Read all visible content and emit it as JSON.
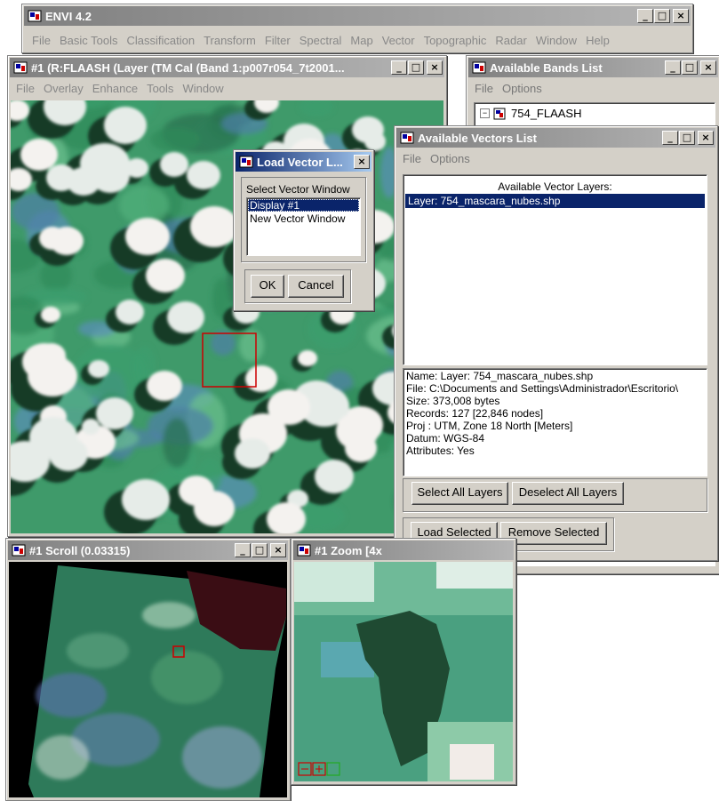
{
  "main": {
    "title": "ENVI 4.2",
    "menu": [
      "File",
      "Basic Tools",
      "Classification",
      "Transform",
      "Filter",
      "Spectral",
      "Map",
      "Vector",
      "Topographic",
      "Radar",
      "Window",
      "Help"
    ]
  },
  "image_window": {
    "title": "#1 (R:FLAASH (Layer (TM Cal (Band 1:p007r054_7t2001...",
    "menu": [
      "File",
      "Overlay",
      "Enhance",
      "Tools",
      "Window"
    ]
  },
  "bands_list": {
    "title": "Available Bands List",
    "menu": [
      "File",
      "Options"
    ],
    "tree_item": "754_FLAASH"
  },
  "vectors_list": {
    "title": "Available Vectors List",
    "menu": [
      "File",
      "Options"
    ],
    "layers_header": "Available Vector Layers:",
    "layers": [
      "Layer: 754_mascara_nubes.shp"
    ],
    "info": [
      "Name: Layer: 754_mascara_nubes.shp",
      "File: C:\\Documents and Settings\\Administrador\\Escritorio\\",
      "Size: 373,008 bytes",
      "Records: 127 [22,846 nodes]",
      "Proj : UTM, Zone 18 North [Meters]",
      "Datum: WGS-84",
      "Attributes: Yes"
    ],
    "select_all": "Select All Layers",
    "deselect_all": "Deselect All Layers",
    "load_selected": "Load Selected",
    "remove_selected": "Remove Selected"
  },
  "load_dialog": {
    "title": "Load Vector L...",
    "label": "Select Vector Window",
    "options": [
      "Display #1",
      "New Vector Window"
    ],
    "ok": "OK",
    "cancel": "Cancel"
  },
  "scroll_window": {
    "title": "#1 Scroll (0.03315)"
  },
  "zoom_window": {
    "title": "#1 Zoom [4x"
  },
  "colors": {
    "title_active": "#0a246a",
    "title_inactive": "#808080",
    "selection": "#0a246a",
    "roi_box": "#cc0000"
  }
}
